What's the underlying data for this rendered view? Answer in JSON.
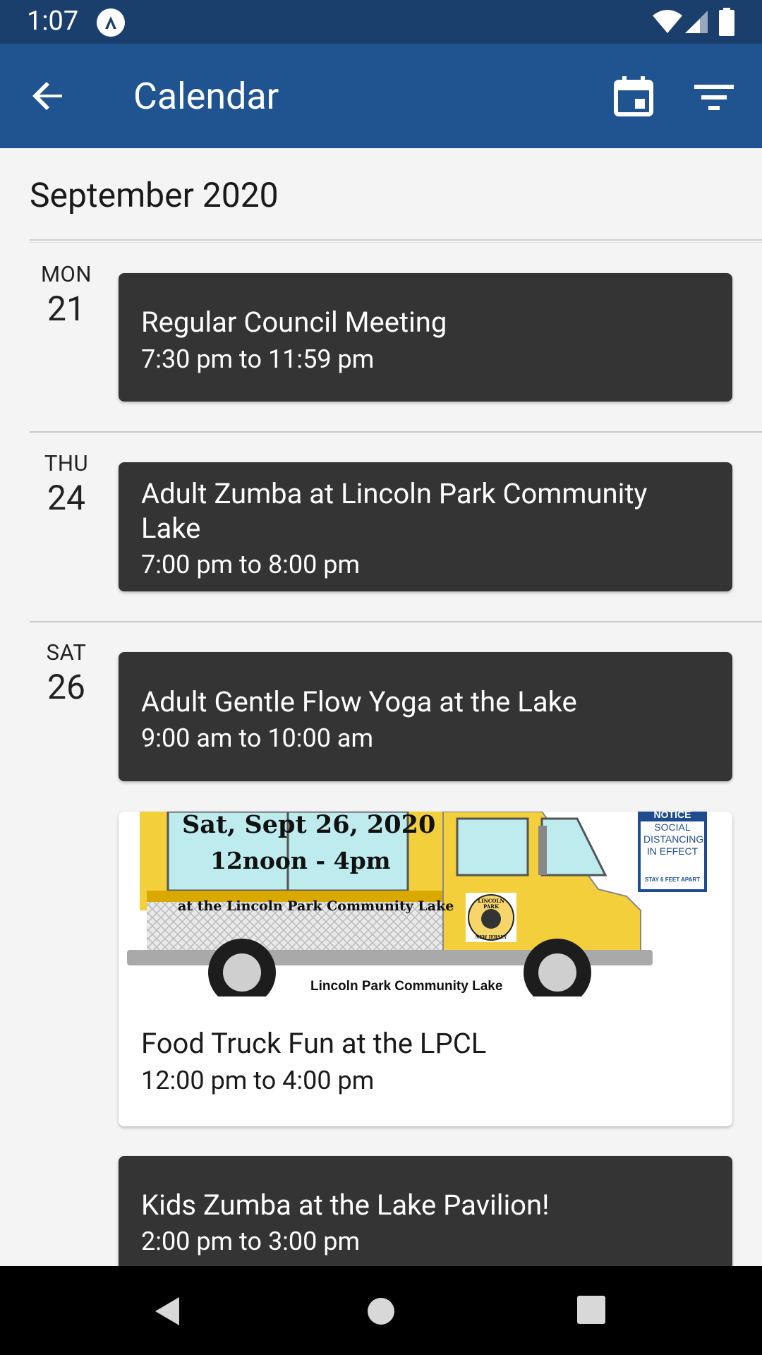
{
  "status_bar": {
    "time": "1:07"
  },
  "app_bar": {
    "title": "Calendar"
  },
  "month_header": "September 2020",
  "days": [
    {
      "day_name": "MON",
      "day_num": "21",
      "events": [
        {
          "title": "Regular Council Meeting",
          "time": "7:30 pm to 11:59 pm"
        }
      ]
    },
    {
      "day_name": "THU",
      "day_num": "24",
      "events": [
        {
          "title": "Adult Zumba at Lincoln Park Community Lake",
          "time": "7:00 pm to 8:00 pm"
        }
      ]
    },
    {
      "day_name": "SAT",
      "day_num": "26",
      "events": [
        {
          "title": "Adult Gentle Flow Yoga at the Lake",
          "time": "9:00 am to 10:00 am"
        },
        {
          "title": "Food Truck Fun at the LPCL",
          "time": "12:00 pm to 4:00 pm",
          "image_text": {
            "date": "Sat, Sept 26, 2020",
            "hours": "12noon - 4pm",
            "location": "at the Lincoln Park Community Lake",
            "caption": "Lincoln Park Community Lake",
            "sign_header": "NOTICE",
            "sign_body": "SOCIAL DISTANCING IN EFFECT",
            "sign_footer": "STAY 6 FEET APART",
            "seal_top": "LINCOLN PARK",
            "seal_bottom": "NEW JERSEY"
          }
        },
        {
          "title": "Kids Zumba at the Lake Pavilion!",
          "time": "2:00 pm to 3:00 pm"
        }
      ]
    }
  ],
  "colors": {
    "app_bar": "#1f5490",
    "status_bar": "#1b3f6c",
    "card_dark": "#343434",
    "background": "#f4f4f4"
  },
  "icons": [
    "back-arrow-icon",
    "calendar-icon",
    "filter-icon"
  ]
}
